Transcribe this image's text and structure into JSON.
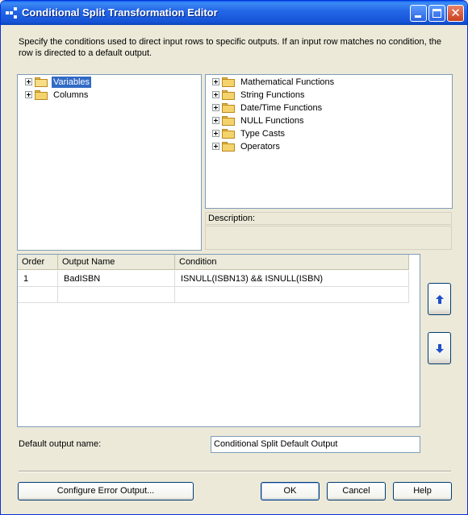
{
  "window": {
    "title": "Conditional Split Transformation Editor",
    "icon": "conditional-split-icon",
    "controls": [
      "minimize",
      "maximize",
      "close"
    ]
  },
  "instructions": "Specify the conditions used to direct input rows to specific outputs. If an input row matches no condition, the row is directed to a default output.",
  "left_tree": {
    "items": [
      {
        "label": "Variables",
        "selected": true,
        "expanded": false,
        "icon": "folder-open-icon"
      },
      {
        "label": "Columns",
        "selected": false,
        "expanded": false,
        "icon": "folder-icon"
      }
    ]
  },
  "right_tree": {
    "items": [
      {
        "label": "Mathematical Functions",
        "icon": "folder-icon"
      },
      {
        "label": "String Functions",
        "icon": "folder-icon"
      },
      {
        "label": "Date/Time Functions",
        "icon": "folder-icon"
      },
      {
        "label": "NULL Functions",
        "icon": "folder-icon"
      },
      {
        "label": "Type Casts",
        "icon": "folder-icon"
      },
      {
        "label": "Operators",
        "icon": "folder-icon"
      }
    ]
  },
  "description": {
    "label": "Description:",
    "value": ""
  },
  "grid": {
    "columns": [
      "Order",
      "Output Name",
      "Condition"
    ],
    "rows": [
      {
        "order": "1",
        "output_name": "BadISBN",
        "condition": "ISNULL(ISBN13) && ISNULL(ISBN)"
      },
      {
        "order": "",
        "output_name": "",
        "condition": ""
      }
    ]
  },
  "move_buttons": {
    "up_icon": "arrow-up-icon",
    "down_icon": "arrow-down-icon",
    "icon_color": "#1E4FC8"
  },
  "default_output": {
    "label": "Default output name:",
    "value": "Conditional Split Default Output"
  },
  "buttons": {
    "configure_error_output": "Configure Error Output...",
    "ok": "OK",
    "cancel": "Cancel",
    "help": "Help"
  },
  "colors": {
    "titlebar": "#2468E8",
    "selection": "#316AC5",
    "dialog_bg": "#ECE9D8",
    "border": "#7F9DB9"
  }
}
